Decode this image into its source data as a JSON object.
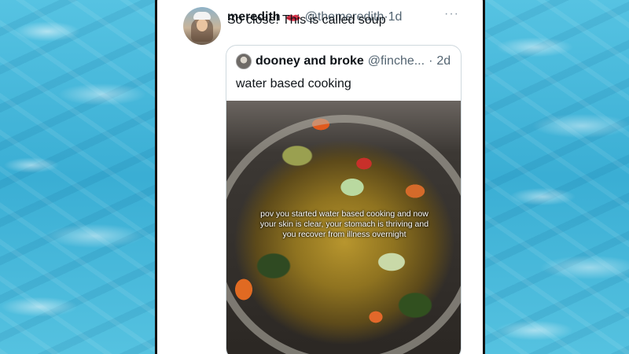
{
  "tweet": {
    "display_name": "meredith",
    "name_emoji": "lips-icon",
    "handle": "@themeredith",
    "separator": "·",
    "time": "1d",
    "more_label": "···",
    "text": "So close! This is called soup"
  },
  "quoted_tweet": {
    "display_name": "dooney and broke",
    "handle": "@finche...",
    "separator": "·",
    "time": "2d",
    "text": "water based cooking",
    "media_overlay_text": "pov you started water based cooking and now your skin is clear, your stomach is thriving and you recover from illness overnight"
  },
  "colors": {
    "background": "#3fb3d6",
    "card": "#ffffff",
    "text_primary": "#0f1419",
    "text_secondary": "#536471",
    "border": "#cfd9de"
  }
}
